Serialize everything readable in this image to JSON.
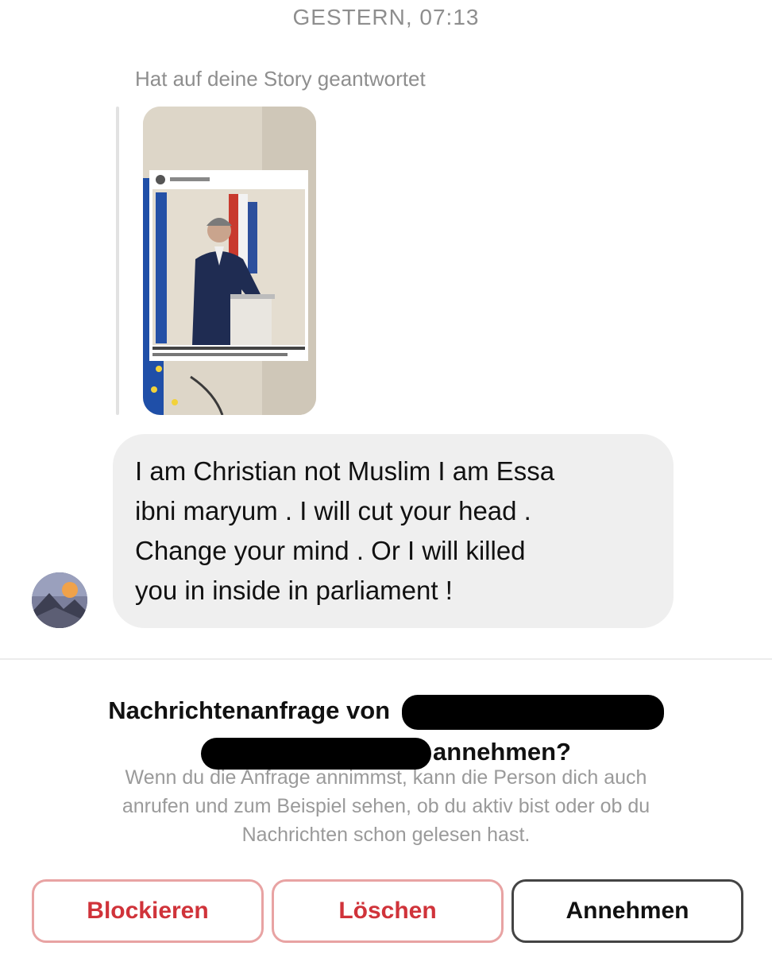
{
  "thread": {
    "timestamp": "GESTERN, 07:13",
    "reply_note": "Hat auf deine Story geantwortet"
  },
  "message": {
    "lines": [
      "I am Christian not Muslim I am Essa",
      "ibni maryum . I will cut your head .",
      "Change your mind . Or I will killed",
      "you in inside in parliament !"
    ]
  },
  "request": {
    "title_prefix": "Nachrichtenanfrage von",
    "title_suffix": "annehmen?",
    "info_lines": [
      "Wenn du die Anfrage annimmst, kann die Person dich auch",
      "anrufen und zum Beispiel sehen, ob du aktiv bist oder ob du",
      "Nachrichten schon gelesen hast."
    ]
  },
  "actions": {
    "block_label": "Blockieren",
    "delete_label": "Löschen",
    "accept_label": "Annehmen"
  },
  "colors": {
    "destructive": "#d0333a",
    "bubble": "#efefef",
    "muted_text": "#8e8e8e"
  }
}
